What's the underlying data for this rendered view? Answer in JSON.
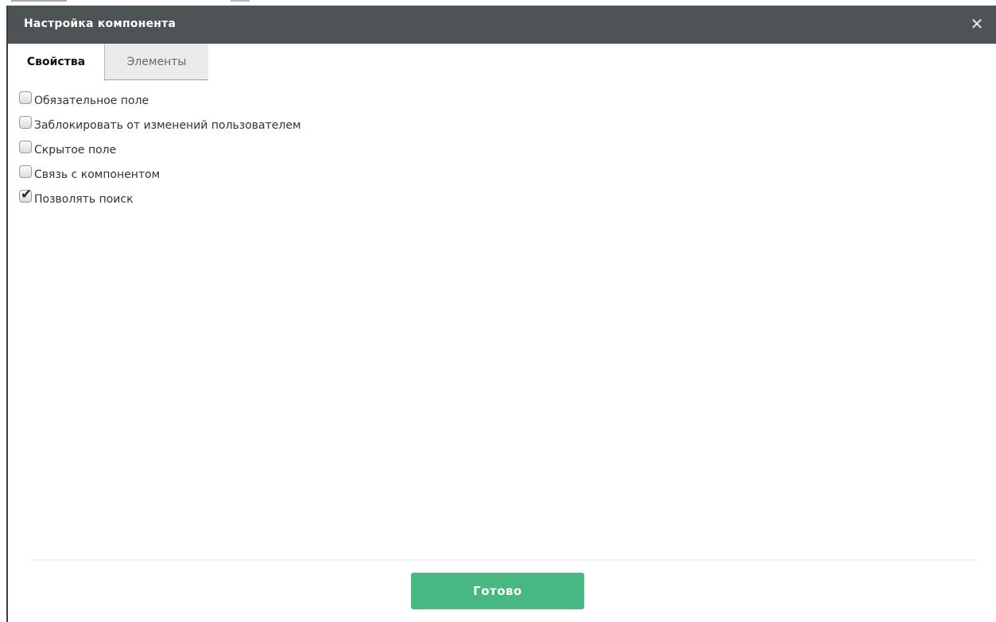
{
  "dialog": {
    "title": "Настройка компонента",
    "close_icon": "close-icon",
    "close_glyph": "✕"
  },
  "tabs": [
    {
      "label": "Свойства",
      "active": true
    },
    {
      "label": "Элементы",
      "active": false
    }
  ],
  "options": [
    {
      "label": "Обязательное поле",
      "checked": false
    },
    {
      "label": "Заблокировать от изменений пользователем",
      "checked": false
    },
    {
      "label": "Скрытое поле",
      "checked": false
    },
    {
      "label": "Связь с компонентом",
      "checked": false
    },
    {
      "label": "Позволять поиск",
      "checked": true
    }
  ],
  "footer": {
    "done_label": "Готово"
  },
  "colors": {
    "titlebar": "#4e5356",
    "done_button": "#48b883",
    "inactive_tab": "#ebebeb"
  }
}
